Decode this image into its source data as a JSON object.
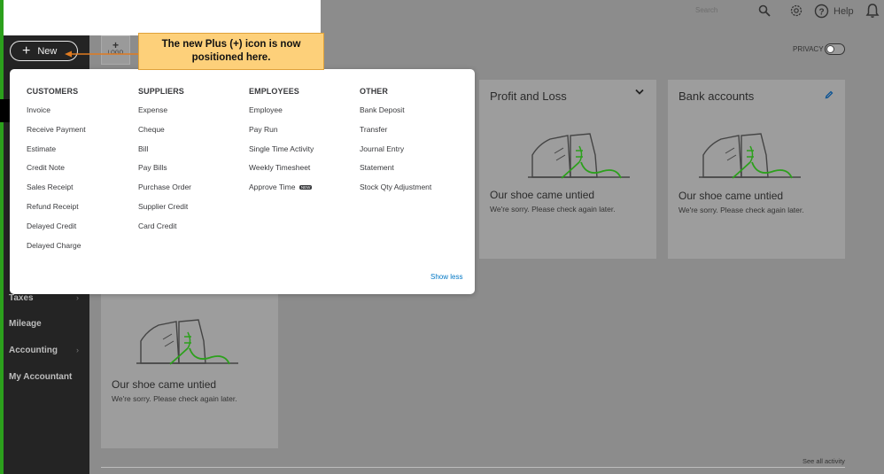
{
  "header": {
    "search_placeholder": "Search",
    "help_label": "Help"
  },
  "new_button": {
    "label": "New"
  },
  "logo_placeholder": {
    "label": "LOGO"
  },
  "callout": {
    "text": "The new Plus (+) icon is now positioned here."
  },
  "privacy": {
    "label": "PRIVACY",
    "enabled": false
  },
  "sidebar": {
    "items": [
      {
        "label": "Taxes",
        "has_chevron": true
      },
      {
        "label": "Mileage",
        "has_chevron": false
      },
      {
        "label": "Accounting",
        "has_chevron": true
      },
      {
        "label": "My Accountant",
        "has_chevron": false
      }
    ]
  },
  "new_menu": {
    "columns": [
      {
        "heading": "CUSTOMERS",
        "items": [
          "Invoice",
          "Receive Payment",
          "Estimate",
          "Credit Note",
          "Sales Receipt",
          "Refund Receipt",
          "Delayed Credit",
          "Delayed Charge"
        ]
      },
      {
        "heading": "SUPPLIERS",
        "items": [
          "Expense",
          "Cheque",
          "Bill",
          "Pay Bills",
          "Purchase Order",
          "Supplier Credit",
          "Card Credit"
        ]
      },
      {
        "heading": "EMPLOYEES",
        "items": [
          "Employee",
          "Pay Run",
          "Single Time Activity",
          "Weekly Timesheet",
          "Approve Time"
        ]
      },
      {
        "heading": "OTHER",
        "items": [
          "Bank Deposit",
          "Transfer",
          "Journal Entry",
          "Statement",
          "Stock Qty Adjustment"
        ]
      }
    ],
    "approve_time_badge": "NEW",
    "show_less_label": "Show less"
  },
  "cards": {
    "profit_loss": {
      "title": "Profit and Loss",
      "message": "Our shoe came untied",
      "sub": "We're sorry. Please check again later."
    },
    "bank_accounts": {
      "title": "Bank accounts",
      "message": "Our shoe came untied",
      "sub": "We're sorry. Please check again later."
    },
    "bottom_left": {
      "message": "Our shoe came untied",
      "sub": "We're sorry. Please check again later."
    }
  },
  "footer": {
    "see_all_activity": "See all activity"
  },
  "colors": {
    "brand_green": "#2ca01c",
    "link_blue": "#0077c5",
    "callout_bg": "#fdd07a"
  }
}
